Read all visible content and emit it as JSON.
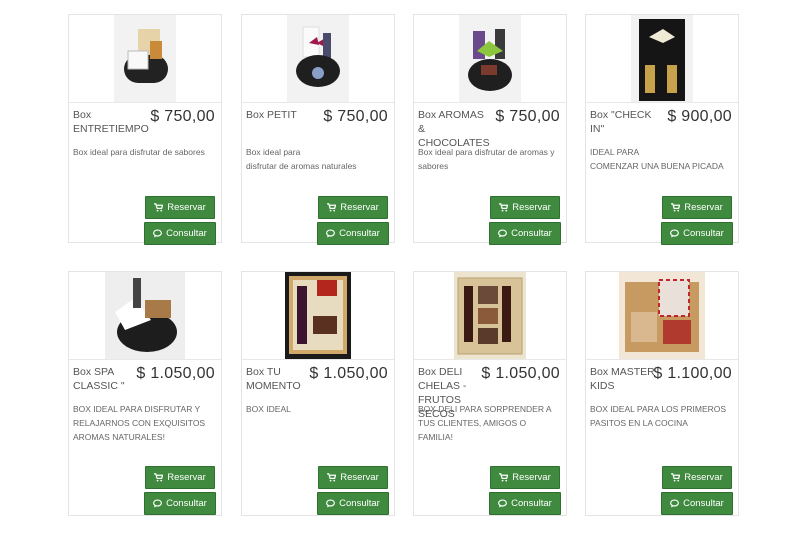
{
  "buttons": {
    "reserve": "Reservar",
    "consult": "Consultar"
  },
  "products": [
    {
      "name": "Box ENTRETIEMPO",
      "price": "$ 750,00",
      "desc": "Box ideal para disfrutar de sabores",
      "image": "gift-box-mug-snacks"
    },
    {
      "name": "Box PETIT",
      "price": "$ 750,00",
      "desc": "Box ideal para\ndisfrutar de aromas naturales",
      "image": "gift-box-candle-bow"
    },
    {
      "name": "Box AROMAS & CHOCOLATES",
      "price": "$ 750,00",
      "desc": "Box ideal para disfrutar de aromas y sabores",
      "image": "gift-box-green-bow"
    },
    {
      "name": "Box \"CHECK IN\"",
      "price": "$ 900,00",
      "desc": "IDEAL PARA\nCOMENZAR UNA BUENA PICADA",
      "image": "gift-box-black-bottles"
    },
    {
      "name": "Box SPA CLASSIC \"",
      "price": "$ 1.050,00",
      "desc": "BOX IDEAL PARA DISFRUTAR Y RELAJARNOS CON EXQUISITOS AROMAS NATURALES!",
      "image": "gift-box-spa"
    },
    {
      "name": "Box TU MOMENTO",
      "price": "$ 1.050,00",
      "desc": "BOX IDEAL",
      "image": "gift-box-wine-straw"
    },
    {
      "name": "Box DELI CHELAS - FRUTOS SECOS",
      "price": "$ 1.050,00",
      "desc": "BOX DELI PARA SORPRENDER A TUS CLIENTES, AMIGOS O FAMILIA!",
      "image": "gift-box-beers-nuts"
    },
    {
      "name": "Box MASTER KIDS",
      "price": "$ 1.100,00",
      "desc": "BOX IDEAL PARA LOS PRIMEROS PASITOS EN LA COCINA",
      "image": "gift-box-kids-kitchen"
    }
  ],
  "icons": {
    "reserve": "cart-icon",
    "consult": "chat-icon"
  },
  "colors": {
    "button": "#3f8a3f",
    "button_border": "#2f6f2f"
  }
}
